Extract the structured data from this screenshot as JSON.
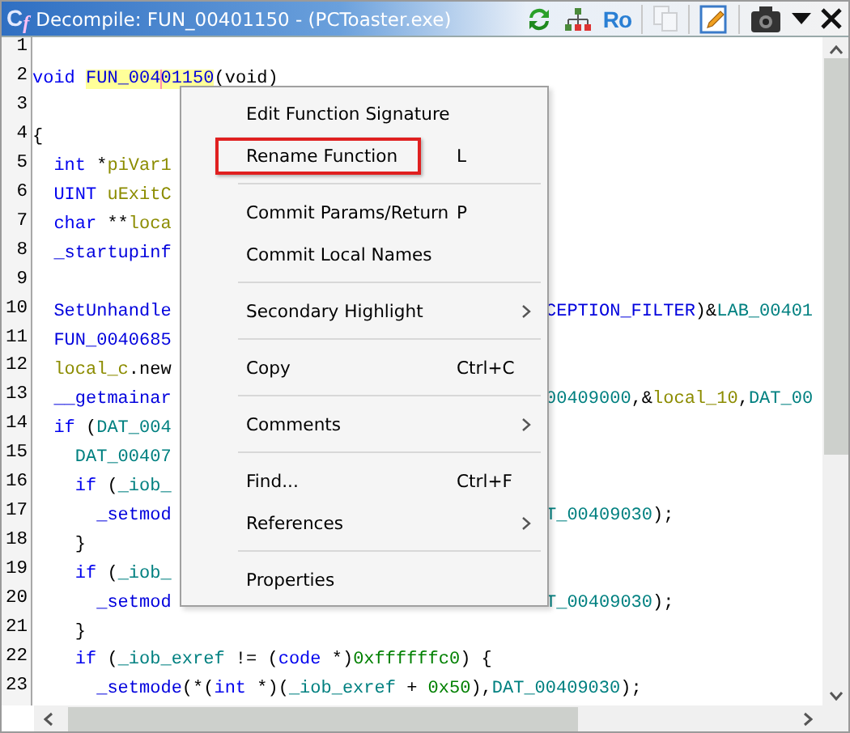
{
  "window": {
    "logo": [
      "C",
      "f"
    ],
    "title": "Decompile: FUN_00401150 -  (PCToaster.exe)"
  },
  "toolbar": [
    {
      "kind": "refresh"
    },
    {
      "kind": "graph"
    },
    {
      "kind": "text",
      "label": "Ro"
    },
    {
      "kind": "separator"
    },
    {
      "kind": "copy",
      "disabled": true
    },
    {
      "kind": "separator"
    },
    {
      "kind": "edit"
    },
    {
      "kind": "separator"
    },
    {
      "kind": "camera"
    },
    {
      "kind": "dropdown"
    },
    {
      "kind": "close"
    }
  ],
  "code_lines": [
    {
      "number": "1"
    },
    {
      "number": "2",
      "left": [
        {
          "text": "void ",
          "kind": "kw"
        },
        {
          "text": "FUN_004",
          "kind": "fn",
          "highlight": true
        },
        {
          "text": "01150",
          "kind": "fn",
          "highlight": true,
          "caret": true
        },
        {
          "text": "(void)",
          "kind": "plain"
        }
      ]
    },
    {
      "number": "3"
    },
    {
      "number": "4",
      "left": [
        {
          "text": "{",
          "kind": "plain"
        }
      ]
    },
    {
      "number": "5",
      "left": [
        {
          "text": "  int",
          "kind": "kw"
        },
        {
          "text": " *",
          "kind": "plain"
        },
        {
          "text": "piVar1",
          "kind": "var"
        }
      ]
    },
    {
      "number": "6",
      "left": [
        {
          "text": "  UINT ",
          "kind": "kw"
        },
        {
          "text": "uExitC",
          "kind": "var"
        }
      ]
    },
    {
      "number": "7",
      "left": [
        {
          "text": "  char",
          "kind": "kw"
        },
        {
          "text": " **",
          "kind": "plain"
        },
        {
          "text": "loca",
          "kind": "var"
        }
      ]
    },
    {
      "number": "8",
      "left": [
        {
          "text": "  _startupinf",
          "kind": "fn"
        }
      ]
    },
    {
      "number": "9"
    },
    {
      "number": "10",
      "left": [
        {
          "text": "  SetUnhandle",
          "kind": "fn"
        }
      ],
      "right": [
        {
          "text": "CEPTION_FILTER",
          "kind": "fn"
        },
        {
          "text": ")&",
          "kind": "plain"
        },
        {
          "text": "LAB_00401",
          "kind": "glob"
        }
      ]
    },
    {
      "number": "11",
      "left": [
        {
          "text": "  FUN_0040685",
          "kind": "fn"
        }
      ]
    },
    {
      "number": "12",
      "left": [
        {
          "text": "  local_c",
          "kind": "var"
        },
        {
          "text": ".new",
          "kind": "plain"
        }
      ]
    },
    {
      "number": "13",
      "left": [
        {
          "text": "  __getmainar",
          "kind": "fn"
        }
      ],
      "right": [
        {
          "text": "00409000",
          "kind": "glob"
        },
        {
          "text": ",&",
          "kind": "plain"
        },
        {
          "text": "local_10",
          "kind": "var"
        },
        {
          "text": ",",
          "kind": "plain"
        },
        {
          "text": "DAT_00",
          "kind": "glob"
        }
      ]
    },
    {
      "number": "14",
      "left": [
        {
          "text": "  if",
          "kind": "kw"
        },
        {
          "text": " (",
          "kind": "plain"
        },
        {
          "text": "DAT_004",
          "kind": "glob"
        }
      ]
    },
    {
      "number": "15",
      "left": [
        {
          "text": "    DAT_00407",
          "kind": "glob"
        }
      ]
    },
    {
      "number": "16",
      "left": [
        {
          "text": "    if",
          "kind": "kw"
        },
        {
          "text": " (",
          "kind": "plain"
        },
        {
          "text": "_iob_",
          "kind": "glob"
        }
      ]
    },
    {
      "number": "17",
      "left": [
        {
          "text": "      _setmod",
          "kind": "fn"
        }
      ],
      "right": [
        {
          "text": "T_00409030",
          "kind": "glob"
        },
        {
          "text": ");",
          "kind": "plain"
        }
      ]
    },
    {
      "number": "18",
      "left": [
        {
          "text": "    }",
          "kind": "plain"
        }
      ]
    },
    {
      "number": "19",
      "left": [
        {
          "text": "    if",
          "kind": "kw"
        },
        {
          "text": " (",
          "kind": "plain"
        },
        {
          "text": "_iob_",
          "kind": "glob"
        }
      ]
    },
    {
      "number": "20",
      "left": [
        {
          "text": "      _setmod",
          "kind": "fn"
        }
      ],
      "right": [
        {
          "text": "T_00409030",
          "kind": "glob"
        },
        {
          "text": ");",
          "kind": "plain"
        }
      ]
    },
    {
      "number": "21",
      "left": [
        {
          "text": "    }",
          "kind": "plain"
        }
      ]
    },
    {
      "number": "22",
      "left": [
        {
          "text": "    if",
          "kind": "kw"
        },
        {
          "text": " (",
          "kind": "plain"
        },
        {
          "text": "_iob_exref",
          "kind": "glob"
        },
        {
          "text": " != (",
          "kind": "plain"
        },
        {
          "text": "code",
          "kind": "kw"
        },
        {
          "text": " *)",
          "kind": "plain"
        },
        {
          "text": "0xffffffc0",
          "kind": "num"
        },
        {
          "text": ") {",
          "kind": "plain"
        }
      ]
    },
    {
      "number": "23",
      "left": [
        {
          "text": "      _setmode",
          "kind": "fn"
        },
        {
          "text": "(*(",
          "kind": "plain"
        },
        {
          "text": "int",
          "kind": "kw"
        },
        {
          "text": " *)(",
          "kind": "plain"
        },
        {
          "text": "_iob_exref",
          "kind": "glob"
        },
        {
          "text": " + ",
          "kind": "plain"
        },
        {
          "text": "0x50",
          "kind": "num"
        },
        {
          "text": "),",
          "kind": "plain"
        },
        {
          "text": "DAT_00409030",
          "kind": "glob"
        },
        {
          "text": ");",
          "kind": "plain"
        }
      ]
    }
  ],
  "context_menu": [
    {
      "kind": "item",
      "label": "Edit Function Signature",
      "highlighted": false
    },
    {
      "kind": "item",
      "label": "Rename Function",
      "shortcut": "L",
      "highlighted": true
    },
    {
      "kind": "separator"
    },
    {
      "kind": "item",
      "label": "Commit Params/Return",
      "shortcut": "P",
      "highlighted": false
    },
    {
      "kind": "item",
      "label": "Commit Local Names",
      "highlighted": false
    },
    {
      "kind": "separator"
    },
    {
      "kind": "item",
      "label": "Secondary Highlight",
      "submenu": true,
      "highlighted": false
    },
    {
      "kind": "separator"
    },
    {
      "kind": "item",
      "label": "Copy",
      "shortcut": "Ctrl+C",
      "highlighted": false
    },
    {
      "kind": "separator"
    },
    {
      "kind": "item",
      "label": "Comments",
      "submenu": true,
      "highlighted": false
    },
    {
      "kind": "separator"
    },
    {
      "kind": "item",
      "label": "Find...",
      "shortcut": "Ctrl+F",
      "highlighted": false
    },
    {
      "kind": "item",
      "label": "References",
      "submenu": true,
      "highlighted": false
    },
    {
      "kind": "separator"
    },
    {
      "kind": "item",
      "label": "Properties",
      "highlighted": false
    }
  ]
}
